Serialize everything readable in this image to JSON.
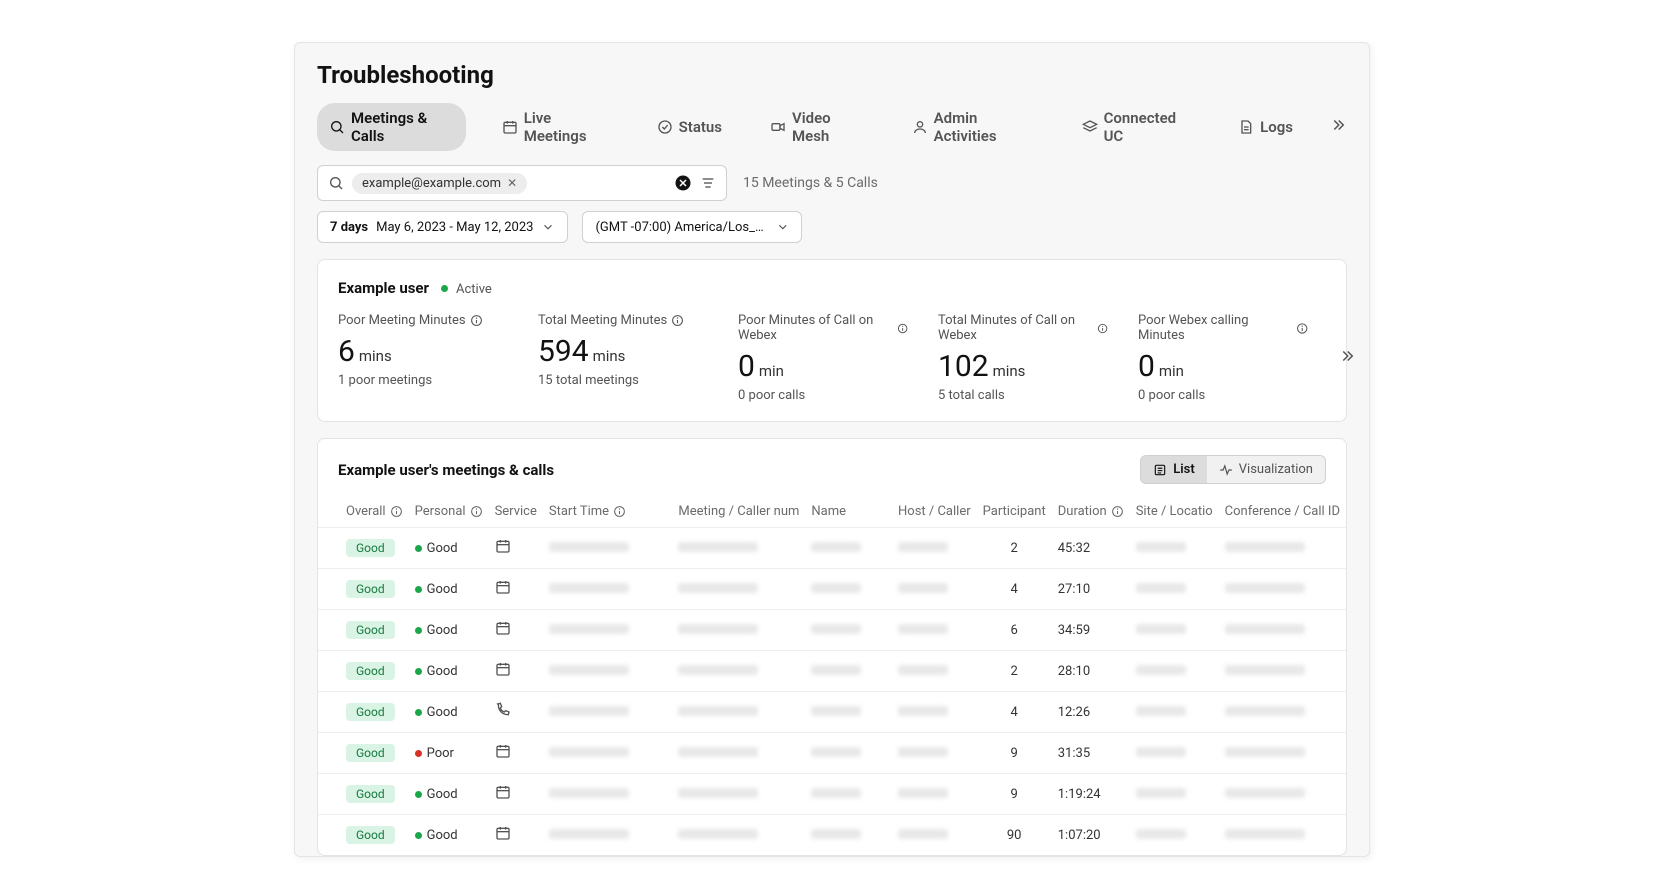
{
  "page": {
    "title": "Troubleshooting"
  },
  "tabs": [
    {
      "label": "Meetings & Calls",
      "active": true
    },
    {
      "label": "Live Meetings"
    },
    {
      "label": "Status"
    },
    {
      "label": "Video Mesh"
    },
    {
      "label": "Admin Activities"
    },
    {
      "label": "Connected UC"
    },
    {
      "label": "Logs"
    }
  ],
  "search": {
    "chip": "example@example.com",
    "results_summary": "15 Meetings & 5 Calls"
  },
  "daterange": {
    "prefix": "7 days",
    "range": "May 6, 2023 - May 12, 2023"
  },
  "timezone": {
    "label": "(GMT -07:00) America/Los_A..."
  },
  "user": {
    "name": "Example user",
    "status": "Active"
  },
  "stats": [
    {
      "label": "Poor Meeting Minutes",
      "value": "6",
      "unit": "mins",
      "sub": "1 poor meetings"
    },
    {
      "label": "Total Meeting Minutes",
      "value": "594",
      "unit": "mins",
      "sub": "15 total meetings"
    },
    {
      "label": "Poor Minutes of Call on Webex",
      "value": "0",
      "unit": "min",
      "sub": "0 poor calls"
    },
    {
      "label": "Total Minutes of Call on Webex",
      "value": "102",
      "unit": "mins",
      "sub": "5 total calls"
    },
    {
      "label": "Poor Webex calling Minutes",
      "value": "0",
      "unit": "min",
      "sub": "0 poor calls"
    }
  ],
  "table": {
    "title": "Example user's meetings & calls",
    "view_list": "List",
    "view_viz": "Visualization",
    "columns": {
      "overall": "Overall",
      "personal": "Personal",
      "service": "Service",
      "start": "Start Time",
      "number": "Meeting / Caller num",
      "name": "Name",
      "host": "Host / Caller",
      "participants": "Participant",
      "duration": "Duration",
      "site": "Site / Locatio",
      "confid": "Conference / Call ID"
    },
    "rows": [
      {
        "overall": "Good",
        "personal": "Good",
        "service": "meeting",
        "participants": "2",
        "duration": "45:32"
      },
      {
        "overall": "Good",
        "personal": "Good",
        "service": "meeting",
        "participants": "4",
        "duration": "27:10"
      },
      {
        "overall": "Good",
        "personal": "Good",
        "service": "meeting",
        "participants": "6",
        "duration": "34:59"
      },
      {
        "overall": "Good",
        "personal": "Good",
        "service": "meeting",
        "participants": "2",
        "duration": "28:10"
      },
      {
        "overall": "Good",
        "personal": "Good",
        "service": "call",
        "participants": "4",
        "duration": "12:26"
      },
      {
        "overall": "Good",
        "personal": "Poor",
        "service": "meeting",
        "participants": "9",
        "duration": "31:35"
      },
      {
        "overall": "Good",
        "personal": "Good",
        "service": "meeting",
        "participants": "9",
        "duration": "1:19:24"
      },
      {
        "overall": "Good",
        "personal": "Good",
        "service": "meeting",
        "participants": "90",
        "duration": "1:07:20"
      }
    ]
  }
}
